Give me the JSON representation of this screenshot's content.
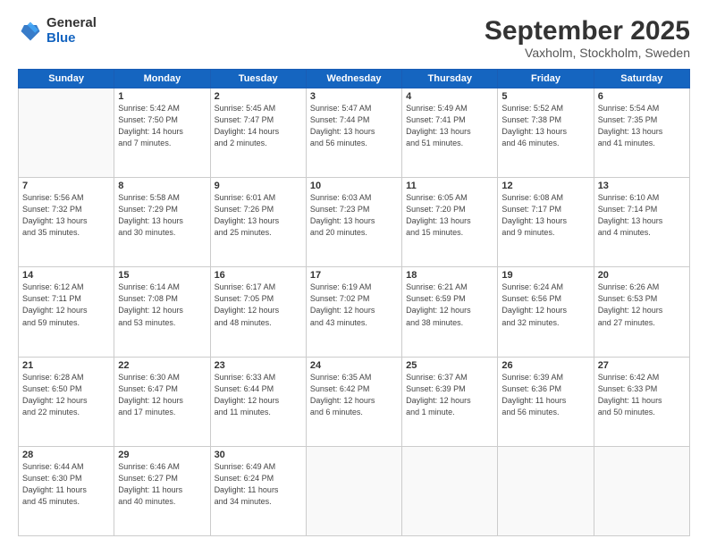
{
  "header": {
    "logo_general": "General",
    "logo_blue": "Blue",
    "title": "September 2025",
    "location": "Vaxholm, Stockholm, Sweden"
  },
  "days_of_week": [
    "Sunday",
    "Monday",
    "Tuesday",
    "Wednesday",
    "Thursday",
    "Friday",
    "Saturday"
  ],
  "weeks": [
    [
      {
        "day": "",
        "info": ""
      },
      {
        "day": "1",
        "info": "Sunrise: 5:42 AM\nSunset: 7:50 PM\nDaylight: 14 hours\nand 7 minutes."
      },
      {
        "day": "2",
        "info": "Sunrise: 5:45 AM\nSunset: 7:47 PM\nDaylight: 14 hours\nand 2 minutes."
      },
      {
        "day": "3",
        "info": "Sunrise: 5:47 AM\nSunset: 7:44 PM\nDaylight: 13 hours\nand 56 minutes."
      },
      {
        "day": "4",
        "info": "Sunrise: 5:49 AM\nSunset: 7:41 PM\nDaylight: 13 hours\nand 51 minutes."
      },
      {
        "day": "5",
        "info": "Sunrise: 5:52 AM\nSunset: 7:38 PM\nDaylight: 13 hours\nand 46 minutes."
      },
      {
        "day": "6",
        "info": "Sunrise: 5:54 AM\nSunset: 7:35 PM\nDaylight: 13 hours\nand 41 minutes."
      }
    ],
    [
      {
        "day": "7",
        "info": "Sunrise: 5:56 AM\nSunset: 7:32 PM\nDaylight: 13 hours\nand 35 minutes."
      },
      {
        "day": "8",
        "info": "Sunrise: 5:58 AM\nSunset: 7:29 PM\nDaylight: 13 hours\nand 30 minutes."
      },
      {
        "day": "9",
        "info": "Sunrise: 6:01 AM\nSunset: 7:26 PM\nDaylight: 13 hours\nand 25 minutes."
      },
      {
        "day": "10",
        "info": "Sunrise: 6:03 AM\nSunset: 7:23 PM\nDaylight: 13 hours\nand 20 minutes."
      },
      {
        "day": "11",
        "info": "Sunrise: 6:05 AM\nSunset: 7:20 PM\nDaylight: 13 hours\nand 15 minutes."
      },
      {
        "day": "12",
        "info": "Sunrise: 6:08 AM\nSunset: 7:17 PM\nDaylight: 13 hours\nand 9 minutes."
      },
      {
        "day": "13",
        "info": "Sunrise: 6:10 AM\nSunset: 7:14 PM\nDaylight: 13 hours\nand 4 minutes."
      }
    ],
    [
      {
        "day": "14",
        "info": "Sunrise: 6:12 AM\nSunset: 7:11 PM\nDaylight: 12 hours\nand 59 minutes."
      },
      {
        "day": "15",
        "info": "Sunrise: 6:14 AM\nSunset: 7:08 PM\nDaylight: 12 hours\nand 53 minutes."
      },
      {
        "day": "16",
        "info": "Sunrise: 6:17 AM\nSunset: 7:05 PM\nDaylight: 12 hours\nand 48 minutes."
      },
      {
        "day": "17",
        "info": "Sunrise: 6:19 AM\nSunset: 7:02 PM\nDaylight: 12 hours\nand 43 minutes."
      },
      {
        "day": "18",
        "info": "Sunrise: 6:21 AM\nSunset: 6:59 PM\nDaylight: 12 hours\nand 38 minutes."
      },
      {
        "day": "19",
        "info": "Sunrise: 6:24 AM\nSunset: 6:56 PM\nDaylight: 12 hours\nand 32 minutes."
      },
      {
        "day": "20",
        "info": "Sunrise: 6:26 AM\nSunset: 6:53 PM\nDaylight: 12 hours\nand 27 minutes."
      }
    ],
    [
      {
        "day": "21",
        "info": "Sunrise: 6:28 AM\nSunset: 6:50 PM\nDaylight: 12 hours\nand 22 minutes."
      },
      {
        "day": "22",
        "info": "Sunrise: 6:30 AM\nSunset: 6:47 PM\nDaylight: 12 hours\nand 17 minutes."
      },
      {
        "day": "23",
        "info": "Sunrise: 6:33 AM\nSunset: 6:44 PM\nDaylight: 12 hours\nand 11 minutes."
      },
      {
        "day": "24",
        "info": "Sunrise: 6:35 AM\nSunset: 6:42 PM\nDaylight: 12 hours\nand 6 minutes."
      },
      {
        "day": "25",
        "info": "Sunrise: 6:37 AM\nSunset: 6:39 PM\nDaylight: 12 hours\nand 1 minute."
      },
      {
        "day": "26",
        "info": "Sunrise: 6:39 AM\nSunset: 6:36 PM\nDaylight: 11 hours\nand 56 minutes."
      },
      {
        "day": "27",
        "info": "Sunrise: 6:42 AM\nSunset: 6:33 PM\nDaylight: 11 hours\nand 50 minutes."
      }
    ],
    [
      {
        "day": "28",
        "info": "Sunrise: 6:44 AM\nSunset: 6:30 PM\nDaylight: 11 hours\nand 45 minutes."
      },
      {
        "day": "29",
        "info": "Sunrise: 6:46 AM\nSunset: 6:27 PM\nDaylight: 11 hours\nand 40 minutes."
      },
      {
        "day": "30",
        "info": "Sunrise: 6:49 AM\nSunset: 6:24 PM\nDaylight: 11 hours\nand 34 minutes."
      },
      {
        "day": "",
        "info": ""
      },
      {
        "day": "",
        "info": ""
      },
      {
        "day": "",
        "info": ""
      },
      {
        "day": "",
        "info": ""
      }
    ]
  ]
}
